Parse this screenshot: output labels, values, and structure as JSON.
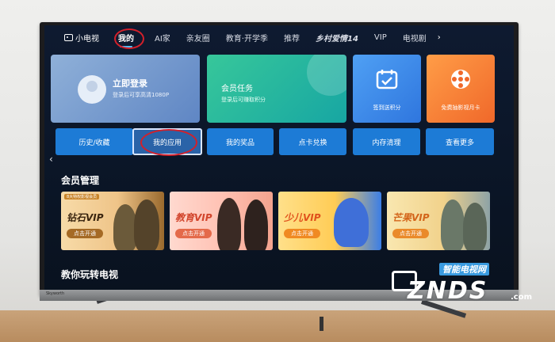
{
  "nav": {
    "logo": "小电视",
    "tabs": [
      "我的",
      "AI家",
      "亲友圈",
      "教育·开学季",
      "推荐",
      "乡村爱情14",
      "VIP",
      "电视剧"
    ],
    "more": "›"
  },
  "cards": {
    "login": {
      "title": "立即登录",
      "subtitle": "登录后可享高清1080P"
    },
    "task": {
      "title": "会员任务",
      "subtitle": "登录后可赚取积分"
    },
    "sign": {
      "caption": "签到送积分"
    },
    "free": {
      "caption": "免费抽影视月卡"
    }
  },
  "buttons": [
    "历史/收藏",
    "我的应用",
    "我的奖品",
    "点卡兑换",
    "内存清理",
    "查看更多"
  ],
  "left_arrow": "‹",
  "member": {
    "title": "会员管理",
    "items": [
      {
        "name": "钻石VIP",
        "cta": "点击开通",
        "tag": "8大特权影视会员"
      },
      {
        "name": "教育VIP",
        "cta": "点击开通"
      },
      {
        "name": "少儿VIP",
        "cta": "点击开通"
      },
      {
        "name": "芒果VIP",
        "cta": "点击开通"
      }
    ]
  },
  "section2": {
    "title": "教你玩转电视"
  },
  "watermark": {
    "top": "智能电视网",
    "big": "ZNDS",
    "com": ".com"
  },
  "brand_text": "Skyworth",
  "colors": {
    "accent": "#1d7bd6",
    "highlight_ring": "#d3202a",
    "active_underline": "#4fc3ff"
  }
}
